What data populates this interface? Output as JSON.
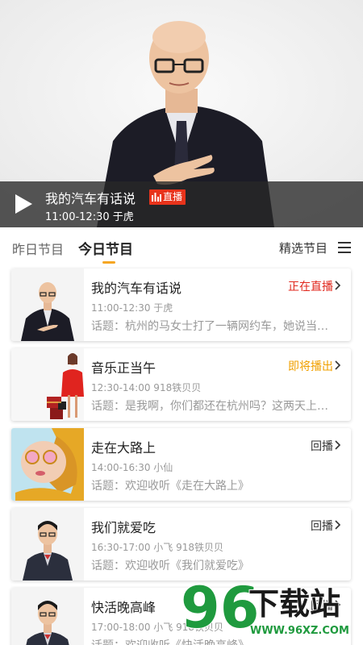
{
  "player": {
    "title": "我的汽车有话说",
    "live_label": "直播",
    "time": "11:00-12:30",
    "host": "于虎",
    "subtitle": "11:00-12:30  于虎"
  },
  "tabs": {
    "yesterday": "昨日节目",
    "today": "今日节目",
    "selected": "精选节目"
  },
  "programs": [
    {
      "title": "我的汽车有话说",
      "status": "正在直播",
      "status_color": "#e0271c",
      "time_host": "11:00-12:30  于虎",
      "topic": "话题：杭州的马女士打了一辆网约车，她说当…"
    },
    {
      "title": "音乐正当午",
      "status": "即将播出",
      "status_color": "#f0a000",
      "time_host": "12:30-14:00  918铁贝贝",
      "topic": "话题：是我啊，你们都还在杭州吗？这两天上…"
    },
    {
      "title": "走在大路上",
      "status": "回播",
      "status_color": "#333333",
      "time_host": "14:00-16:30  小仙",
      "topic": "话题：欢迎收听《走在大路上》"
    },
    {
      "title": "我们就爱吃",
      "status": "回播",
      "status_color": "#333333",
      "time_host": "16:30-17:00  小飞 918铁贝贝",
      "topic": "话题：欢迎收听《我们就爱吃》"
    },
    {
      "title": "快活晚高峰",
      "status": "回播",
      "status_color": "#333333",
      "time_host": "17:00-18:00  小飞 918铁贝贝",
      "topic": "话题：欢迎收听《快活晚高峰》"
    }
  ],
  "watermark": {
    "number": "96",
    "text": "下载站",
    "url": "WWW.96XZ.COM"
  },
  "colors": {
    "accent": "#f5a623",
    "live_red": "#e8331b",
    "watermark_green": "#1f9a3e"
  }
}
